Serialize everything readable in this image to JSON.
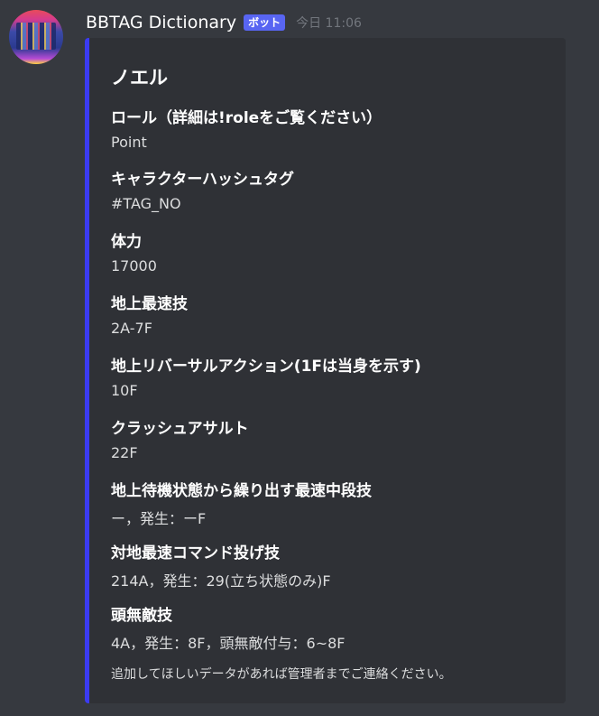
{
  "message": {
    "author": "BBTAG Dictionary",
    "bot_tag": "ボット",
    "timestamp": "今日 11:06"
  },
  "embed": {
    "accent_color": "#3b3bf2",
    "title": "ノエル",
    "fields": [
      {
        "name": "ロール（詳細は!roleをご覧ください）",
        "value": "Point"
      },
      {
        "name": "キャラクターハッシュタグ",
        "value": "#TAG_NO"
      },
      {
        "name": "体力",
        "value": "17000"
      },
      {
        "name": "地上最速技",
        "value": "2A-7F"
      },
      {
        "name": "地上リバーサルアクション(1Fは当身を示す)",
        "value": "10F"
      },
      {
        "name": "クラッシュアサルト",
        "value": "22F"
      },
      {
        "name": "地上待機状態から繰り出す最速中段技",
        "value": "ー，発生：ーF"
      },
      {
        "name": "対地最速コマンド投げ技",
        "value": "214A，発生：29(立ち状態のみ)F"
      },
      {
        "name": "頭無敵技",
        "value": "4A，発生：8F，頭無敵付与：6~8F"
      }
    ],
    "footer": "追加してほしいデータがあれば管理者までご連絡ください。"
  }
}
